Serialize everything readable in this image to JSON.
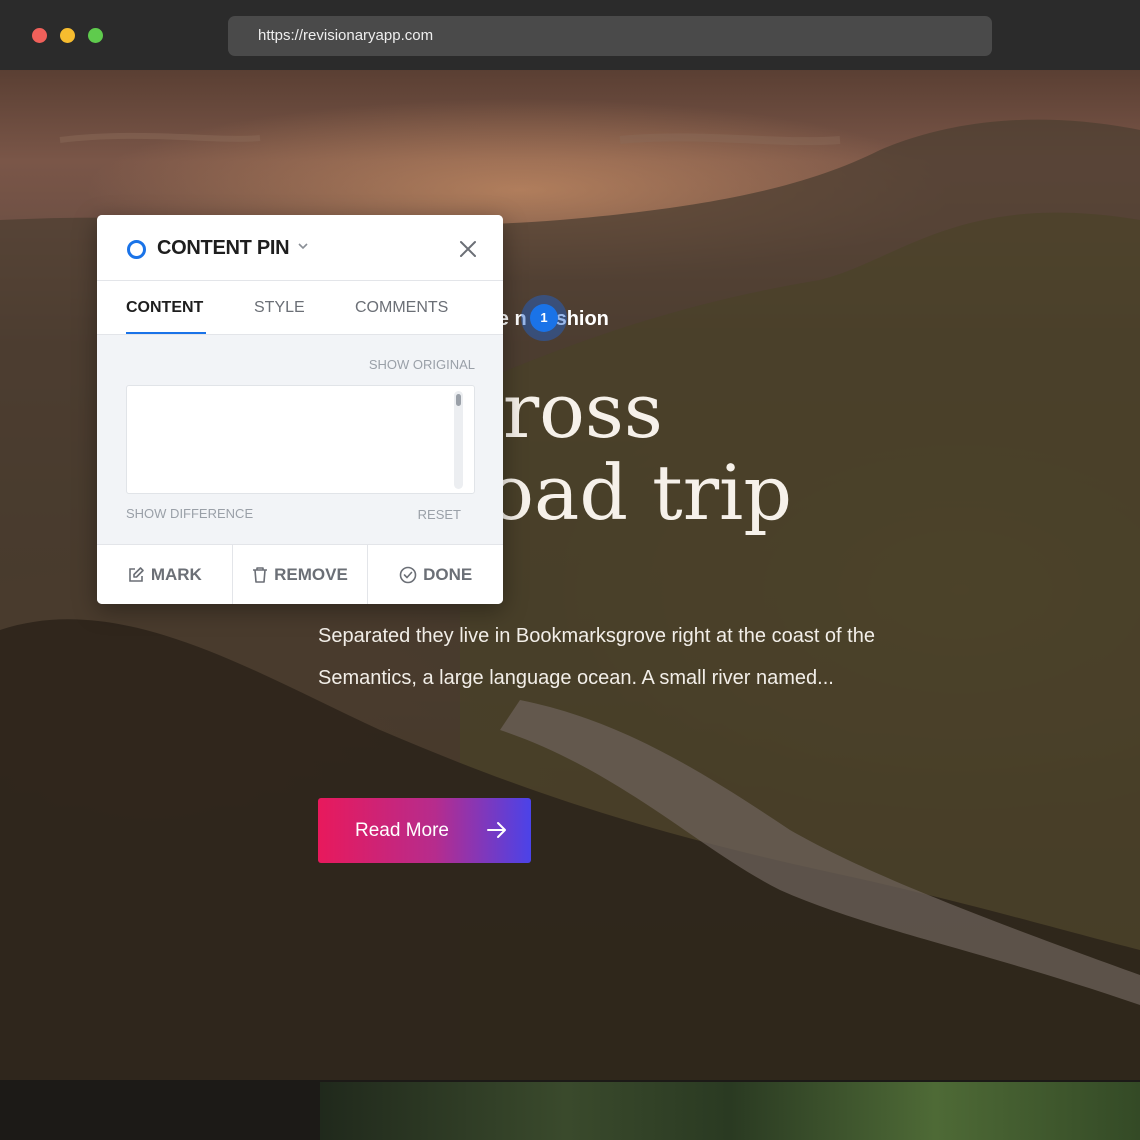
{
  "browser": {
    "url": "https://revisionaryapp.com"
  },
  "article": {
    "category": "ine n Fashion",
    "title_line1": "g a cross",
    "title_line2": "try road trip",
    "excerpt": "Separated they live in Bookmarksgrove right at the coast of the Semantics, a large language ocean. A small river named...",
    "read_more": "Read More"
  },
  "pin_marker": {
    "number": "1"
  },
  "panel": {
    "title": "CONTENT PIN",
    "tabs": [
      "CONTENT",
      "STYLE",
      "COMMENTS"
    ],
    "active_tab": "CONTENT",
    "show_original": "SHOW ORIGINAL",
    "content_value": "",
    "show_difference": "SHOW DIFFERENCE",
    "reset": "RESET",
    "actions": {
      "mark": "MARK",
      "remove": "REMOVE",
      "done": "DONE"
    }
  },
  "colors": {
    "accent_blue": "#1a73e8",
    "button_gradient_start": "#e8195c",
    "button_gradient_end": "#4b43e8"
  },
  "icons": {
    "pin_type": "circle-ring-icon",
    "dropdown": "chevron-down-icon",
    "close": "close-icon",
    "mark": "edit-icon",
    "remove": "trash-icon",
    "done": "check-circle-icon",
    "read_more": "arrow-right-icon"
  }
}
